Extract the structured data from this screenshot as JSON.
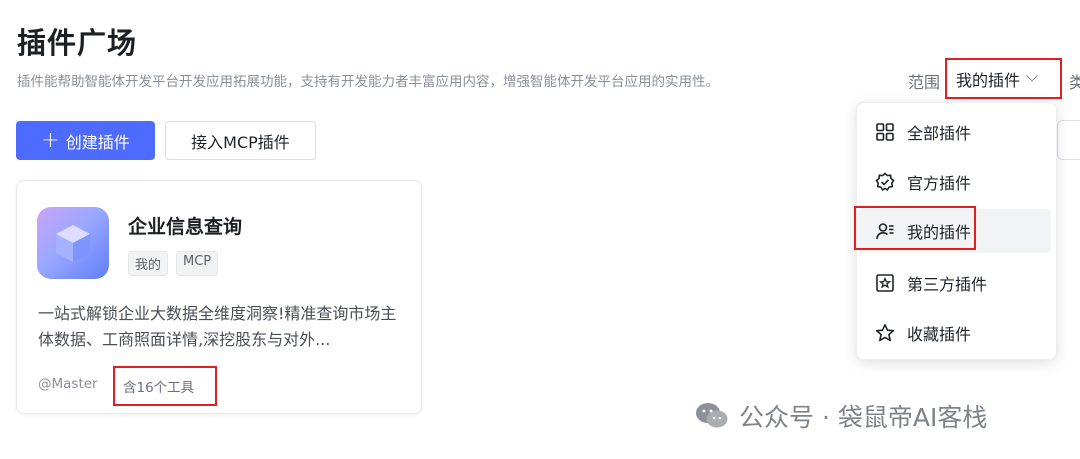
{
  "page": {
    "title": "插件广场",
    "description": "插件能帮助智能体开发平台开发应用拓展功能，支持有开发能力者丰富应用内容，增强智能体开发平台应用的实用性。"
  },
  "filters": {
    "scope_label": "范围",
    "scope_value": "我的插件",
    "type_label": "类"
  },
  "actions": {
    "create_label": "创建插件",
    "mcp_label": "接入MCP插件"
  },
  "plugin_card": {
    "name": "企业信息查询",
    "tags": [
      "我的",
      "MCP"
    ],
    "description": "一站式解锁企业大数据全维度洞察!精准查询市场主体数据、工商照面详情,深挖股东与对外...",
    "author": "@Master",
    "tools_count": "含16个工具"
  },
  "scope_menu": {
    "items": [
      {
        "label": "全部插件",
        "icon": "grid-icon"
      },
      {
        "label": "官方插件",
        "icon": "verified-badge-icon"
      },
      {
        "label": "我的插件",
        "icon": "user-list-icon"
      },
      {
        "label": "第三方插件",
        "icon": "third-party-icon"
      },
      {
        "label": "收藏插件",
        "icon": "star-icon"
      }
    ],
    "selected": "我的插件"
  },
  "watermark": {
    "text": "公众号 · 袋鼠帝AI客栈"
  },
  "colors": {
    "primary": "#4d6bfe",
    "highlight": "#e02020"
  }
}
